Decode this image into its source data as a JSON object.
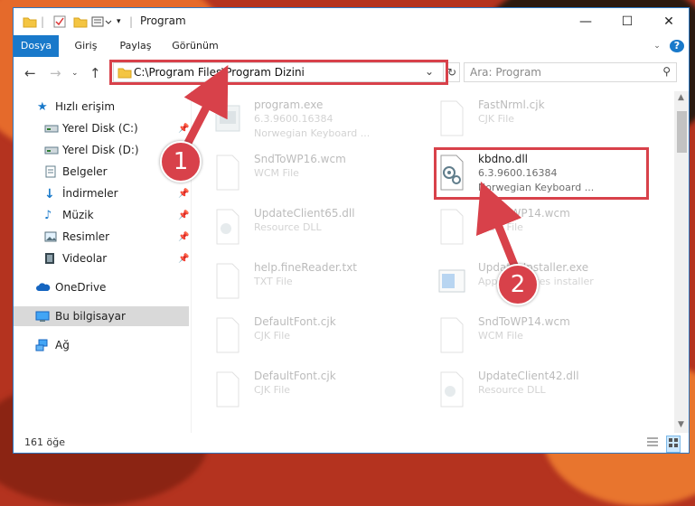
{
  "window": {
    "title": "Program"
  },
  "ribbon": {
    "tabs": [
      "Dosya",
      "Giriş",
      "Paylaş",
      "Görünüm"
    ]
  },
  "address": {
    "path": "C:\\Program Files\\Program Dizini"
  },
  "search": {
    "placeholder": "Ara: Program"
  },
  "sidebar": {
    "quick_access": "Hızlı erişim",
    "items": [
      {
        "label": "Yerel Disk (C:)",
        "icon": "drive-icon",
        "pinned": true
      },
      {
        "label": "Yerel Disk (D:)",
        "icon": "drive-icon",
        "pinned": false
      },
      {
        "label": "Belgeler",
        "icon": "documents-icon",
        "pinned": true
      },
      {
        "label": "İndirmeler",
        "icon": "download-icon",
        "pinned": true
      },
      {
        "label": "Müzik",
        "icon": "music-icon",
        "pinned": true
      },
      {
        "label": "Resimler",
        "icon": "pictures-icon",
        "pinned": true
      },
      {
        "label": "Videolar",
        "icon": "videos-icon",
        "pinned": true
      }
    ],
    "onedrive": "OneDrive",
    "this_pc": "Bu bilgisayar",
    "network": "Ağ"
  },
  "files": [
    {
      "name": "program.exe",
      "type": "6.3.9600.16384",
      "desc": "Norwegian Keyboard ...",
      "icon": "exe-icon"
    },
    {
      "name": "FastNrml.cjk",
      "type": "CJK File",
      "desc": "",
      "icon": "file-icon"
    },
    {
      "name": "SndToWP16.wcm",
      "type": "WCM File",
      "desc": "",
      "icon": "file-icon"
    },
    {
      "name": "kbdno.dll",
      "type": "6.3.9600.16384",
      "desc": "Norwegian Keyboard ...",
      "icon": "dll-icon"
    },
    {
      "name": "UpdateClient65.dll",
      "type": "Resource DLL",
      "desc": "",
      "icon": "dll-icon"
    },
    {
      "name": "SndToWP14.wcm",
      "type": "WCM File",
      "desc": "",
      "icon": "file-icon"
    },
    {
      "name": "help.fineReader.txt",
      "type": "TXT File",
      "desc": "",
      "icon": "file-icon"
    },
    {
      "name": "UpdatesInstaller.exe",
      "type": "Apply Updates installer",
      "desc": "",
      "icon": "installer-icon"
    },
    {
      "name": "DefaultFont.cjk",
      "type": "CJK File",
      "desc": "",
      "icon": "file-icon"
    },
    {
      "name": "SndToWP14.wcm",
      "type": "WCM File",
      "desc": "",
      "icon": "file-icon"
    },
    {
      "name": "DefaultFont.cjk",
      "type": "CJK File",
      "desc": "",
      "icon": "file-icon"
    },
    {
      "name": "UpdateClient42.dll",
      "type": "Resource DLL",
      "desc": "",
      "icon": "dll-icon"
    }
  ],
  "status": {
    "count": "161 öğe"
  },
  "annotations": {
    "step1": "1",
    "step2": "2",
    "color": "#d8414a"
  },
  "colors": {
    "accent": "#1979ca",
    "highlight": "#cce8ff"
  }
}
